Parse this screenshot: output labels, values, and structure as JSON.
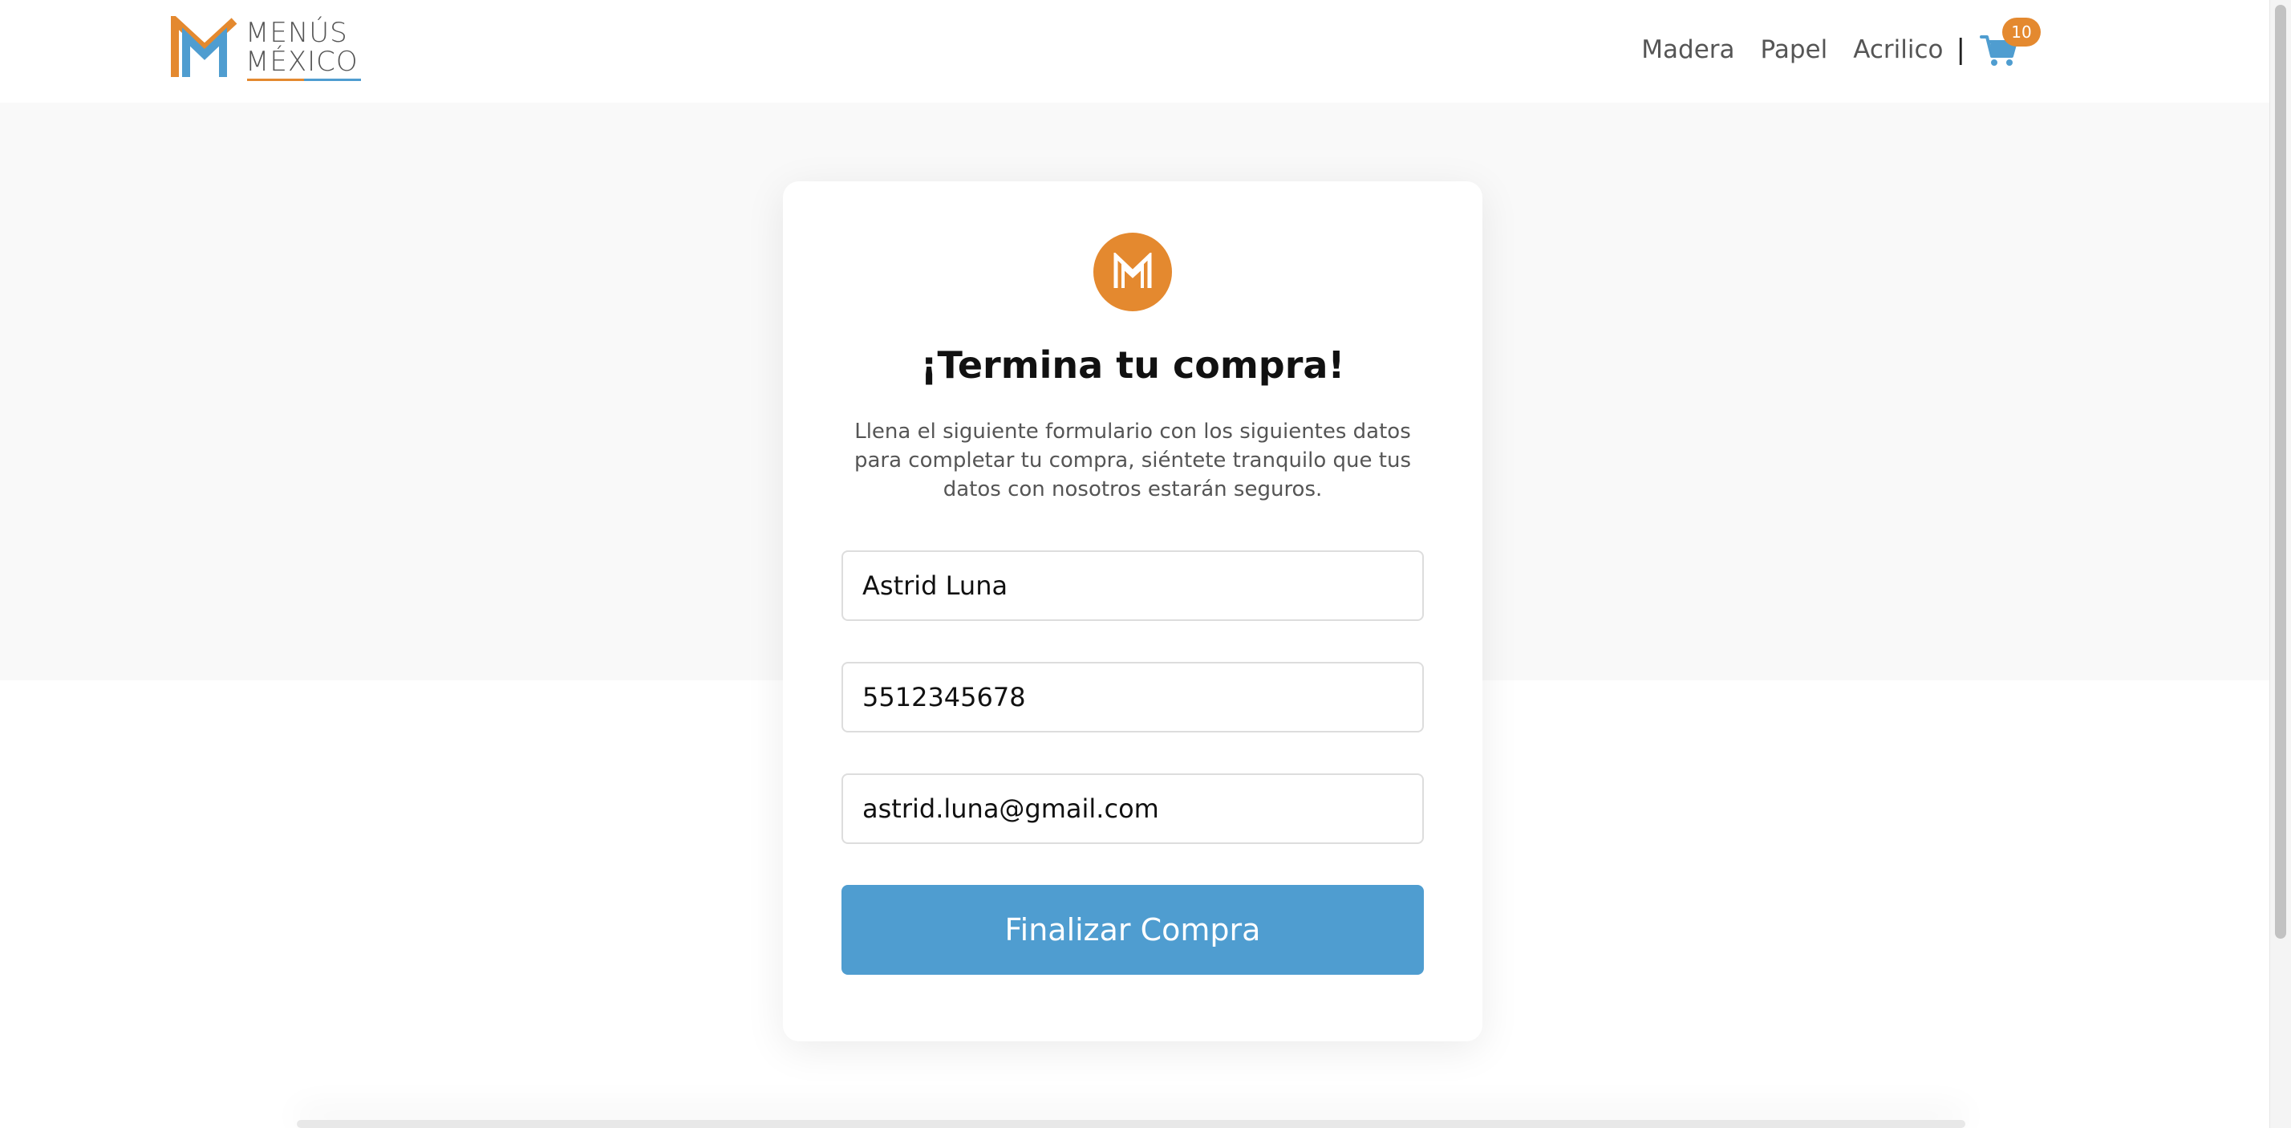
{
  "brand": {
    "logo_line1": "MENÚS",
    "logo_line2": "MÉXICO",
    "logo_icon": "menus-mexico-logo",
    "colors": {
      "orange": "#e4892f",
      "blue": "#4f9dd0"
    }
  },
  "nav": {
    "items": [
      {
        "label": "Madera"
      },
      {
        "label": "Papel"
      },
      {
        "label": "Acrilico"
      }
    ],
    "separator": "|",
    "cart": {
      "icon": "shopping-cart-icon",
      "count": "10"
    }
  },
  "checkout": {
    "title": "¡Termina tu compra!",
    "description": "Llena el siguiente formulario con los siguientes datos para completar tu compra, siéntete tranquilo que tus datos con nosotros estarán seguros.",
    "fields": {
      "name": "Astrid Luna",
      "phone": "5512345678",
      "email": "astrid.luna@gmail.com"
    },
    "submit_label": "Finalizar Compra"
  }
}
